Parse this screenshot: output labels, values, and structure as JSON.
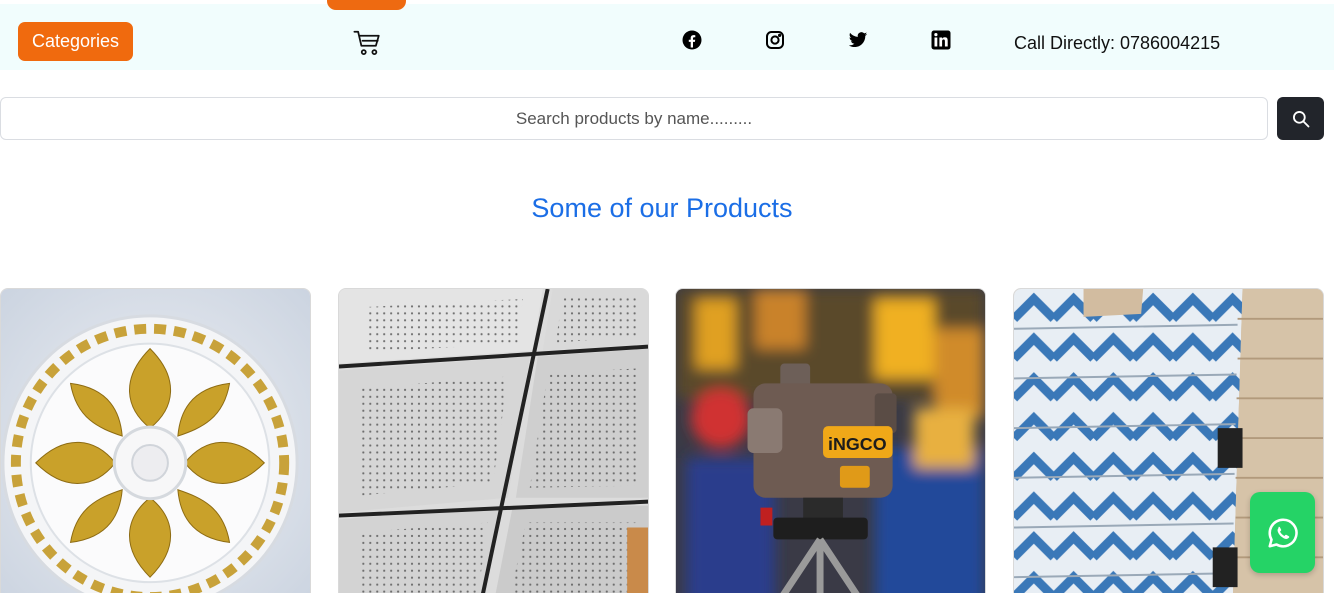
{
  "header": {
    "categories_label": "Categories",
    "call_text": "Call Directly: 0786004215",
    "social_icons": [
      "facebook-icon",
      "instagram-icon",
      "twitter-icon",
      "linkedin-icon"
    ],
    "cart_icon": "cart-icon"
  },
  "search": {
    "placeholder": "Search products by name.........",
    "button_icon": "search-icon"
  },
  "section": {
    "title": "Some of our Products"
  },
  "products": [
    {
      "image": "ceiling-rose-gold-ornament"
    },
    {
      "image": "perforated-ceiling-tiles"
    },
    {
      "image": "ingco-laser-level"
    },
    {
      "image": "stacked-gypsum-boards"
    }
  ],
  "floating": {
    "whatsapp_icon": "whatsapp-icon"
  },
  "colors": {
    "accent_orange": "#f06a0e",
    "topbar_bg": "#f1fdfd",
    "title_blue": "#1b6ee6",
    "search_button": "#22252b",
    "whatsapp_green": "#25d366"
  }
}
